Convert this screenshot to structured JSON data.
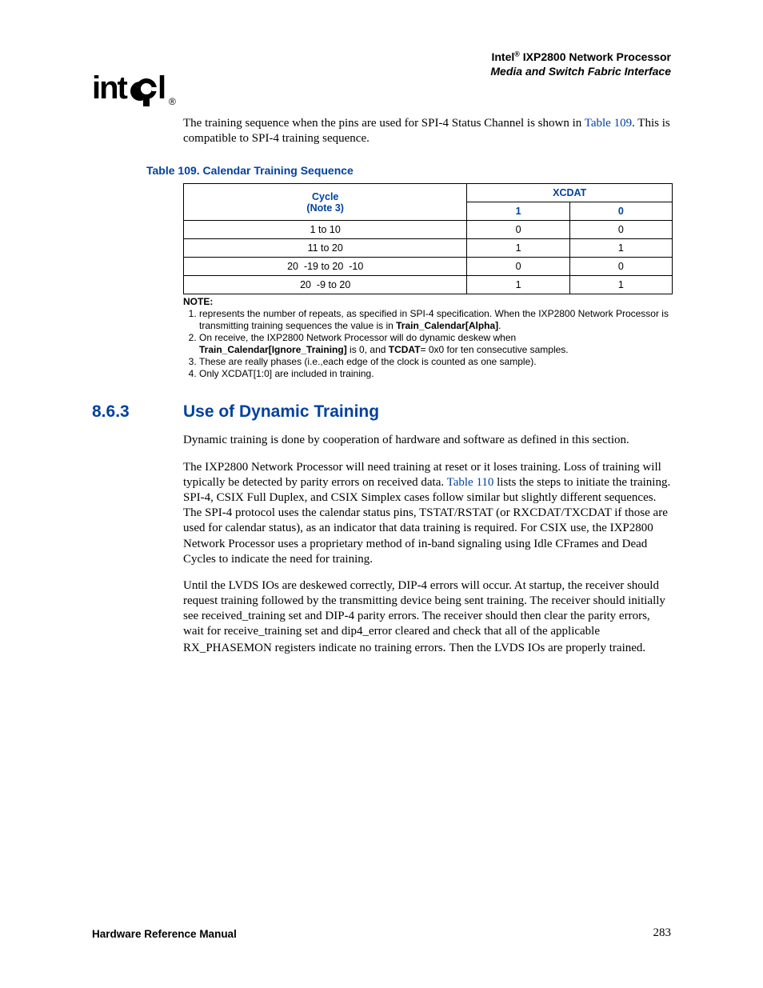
{
  "header": {
    "brand": "Intel",
    "reg": "®",
    "product": " IXP2800 Network Processor",
    "subtitle": "Media and Switch Fabric Interface"
  },
  "intro_para_a": "The training sequence when the pins are used for SPI-4 Status Channel is shown in ",
  "intro_link": "Table 109",
  "intro_para_b": ". This is compatible to SPI-4 training sequence.",
  "table_caption": "Table 109. Calendar Training Sequence",
  "table": {
    "head_cycle_line1": "Cycle",
    "head_cycle_line2": "(Note 3)",
    "head_xcdat": "XCDAT",
    "head_col1": "1",
    "head_col0": "0",
    "rows": [
      {
        "cycle": "1 to 10",
        "c1": "0",
        "c0": "0"
      },
      {
        "cycle": "11 to 20",
        "c1": "1",
        "c0": "1"
      },
      {
        "cycle": "20  -19 to 20  -10",
        "c1": "0",
        "c0": "0"
      },
      {
        "cycle": "20  -9 to 20",
        "c1": "1",
        "c0": "1"
      }
    ]
  },
  "notes": {
    "label": "NOTE:",
    "n1_a": " represents the number of repeats, as specified in SPI-4 specification. When the IXP2800 Network Processor is transmitting training sequences the value is in ",
    "n1_b": "Train_Calendar[Alpha]",
    "n1_c": ".",
    "n2_a": "On receive, the IXP2800 Network Processor will do dynamic deskew when ",
    "n2_b": "Train_Calendar[Ignore_Training]",
    "n2_c": " is 0, and ",
    "n2_d": "TCDAT",
    "n2_e": "= 0x0 for ten consecutive samples.",
    "n3": "These are really phases (i.e.,each edge of the clock is counted as one sample).",
    "n4": "Only XCDAT[1:0] are included in training."
  },
  "section": {
    "num": "8.6.3",
    "title": "Use of Dynamic Training"
  },
  "body": {
    "p1": "Dynamic training is done by cooperation of hardware and software as defined in this section.",
    "p2a": "The IXP2800 Network Processor will need training at reset or it loses training. Loss of training will typically be detected by parity errors on received data. ",
    "p2link": "Table 110",
    "p2b": " lists the steps to initiate the training. SPI-4, CSIX Full Duplex, and CSIX Simplex cases follow similar but slightly different sequences. The SPI-4 protocol uses the calendar status pins, TSTAT/RSTAT (or RXCDAT/TXCDAT if those are used for calendar status), as an indicator that data training is required. For CSIX use, the IXP2800 Network Processor uses a proprietary method of in-band signaling using Idle CFrames and Dead Cycles to indicate the need for training.",
    "p3a": "Until the LVDS IOs are deskewed correctly, DIP-4 errors will occur. At startup, the receiver should request training followed by the transmitting device being sent training. The receiver should initially see received_training set and DIP-4 parity errors. The receiver should then clear the parity errors, wait for receive_training set and dip4_error cleared and check that all of the applicable RX_PHASEMON registers indicate no training errors",
    "p3b": ". ",
    "p3c": "Then the LVDS IOs are properly trained."
  },
  "footer": {
    "left": "Hardware Reference Manual",
    "right": "283"
  }
}
